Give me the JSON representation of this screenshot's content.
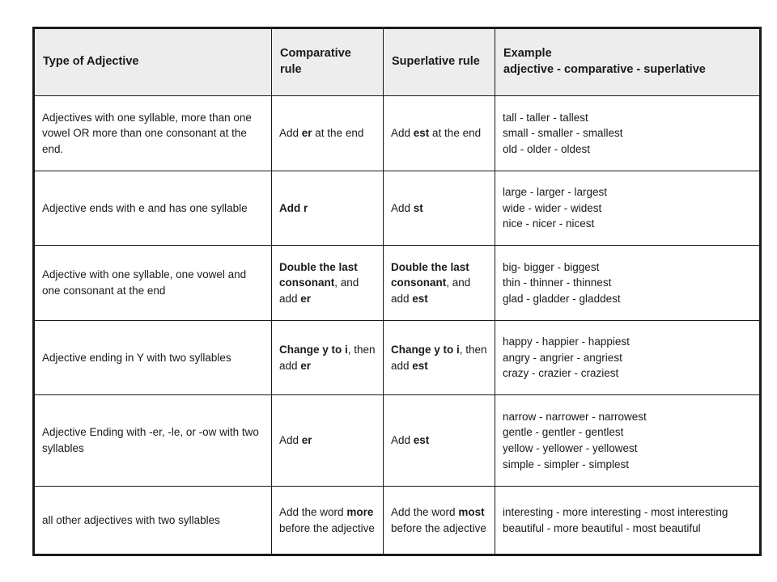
{
  "table": {
    "headers": [
      {
        "lines": [
          "Type of Adjective"
        ]
      },
      {
        "lines": [
          "Comparative",
          "rule"
        ]
      },
      {
        "lines": [
          "Superlative rule"
        ]
      },
      {
        "lines": [
          "Example",
          "adjective - comparative - superlative"
        ]
      }
    ],
    "rows": [
      {
        "type": "Adjectives with one syllable, more than one vowel OR more than one consonant at the end.",
        "comparative": {
          "segments": [
            {
              "t": "Add ",
              "b": false
            },
            {
              "t": "er",
              "b": true
            },
            {
              "t": " at the end",
              "b": false
            }
          ]
        },
        "superlative": {
          "segments": [
            {
              "t": "Add ",
              "b": false
            },
            {
              "t": "est",
              "b": true
            },
            {
              "t": " at the end",
              "b": false
            }
          ]
        },
        "examples": [
          "tall - taller - tallest",
          "small - smaller - smallest",
          "old - older - oldest"
        ]
      },
      {
        "type": "Adjective ends with e and has one syllable",
        "comparative": {
          "segments": [
            {
              "t": "Add r",
              "b": true
            }
          ]
        },
        "superlative": {
          "segments": [
            {
              "t": "Add ",
              "b": false
            },
            {
              "t": "st",
              "b": true
            }
          ]
        },
        "examples": [
          "large - larger - largest",
          "wide - wider - widest",
          "nice - nicer - nicest"
        ]
      },
      {
        "type": "Adjective with one syllable, one vowel and one consonant at the end",
        "comparative": {
          "segments": [
            {
              "t": "Double the last consonant",
              "b": true
            },
            {
              "t": ", and add ",
              "b": false
            },
            {
              "t": "er",
              "b": true
            }
          ]
        },
        "superlative": {
          "segments": [
            {
              "t": "Double the last consonant",
              "b": true
            },
            {
              "t": ", and add ",
              "b": false
            },
            {
              "t": "est",
              "b": true
            }
          ]
        },
        "examples": [
          "big- bigger - biggest",
          "thin - thinner - thinnest",
          "glad - gladder - gladdest"
        ]
      },
      {
        "type": "Adjective ending in Y with two syllables",
        "comparative": {
          "segments": [
            {
              "t": "Change y to i",
              "b": true
            },
            {
              "t": ", then add ",
              "b": false
            },
            {
              "t": "er",
              "b": true
            }
          ]
        },
        "superlative": {
          "segments": [
            {
              "t": "Change y to i",
              "b": true
            },
            {
              "t": ", then add ",
              "b": false
            },
            {
              "t": "est",
              "b": true
            }
          ]
        },
        "examples": [
          "happy - happier - happiest",
          "angry - angrier - angriest",
          "crazy - crazier - craziest"
        ]
      },
      {
        "type": "Adjective Ending with -er, -le, or -ow with two syllables",
        "comparative": {
          "segments": [
            {
              "t": "Add ",
              "b": false
            },
            {
              "t": "er",
              "b": true
            }
          ]
        },
        "superlative": {
          "segments": [
            {
              "t": "Add ",
              "b": false
            },
            {
              "t": "est",
              "b": true
            }
          ]
        },
        "examples": [
          "narrow - narrower - narrowest",
          "gentle - gentler - gentlest",
          "yellow - yellower - yellowest",
          "simple - simpler - simplest"
        ]
      },
      {
        "type": "all other adjectives with two syllables",
        "comparative": {
          "segments": [
            {
              "t": "Add the word ",
              "b": false
            },
            {
              "t": "more",
              "b": true
            },
            {
              "t": " before the adjective",
              "b": false
            }
          ]
        },
        "superlative": {
          "segments": [
            {
              "t": "Add the word ",
              "b": false
            },
            {
              "t": "most",
              "b": true
            },
            {
              "t": " before the adjective",
              "b": false
            }
          ]
        },
        "examples": [
          "interesting - more interesting - most interesting",
          "beautiful - more beautiful - most beautiful"
        ]
      }
    ]
  },
  "colors": {
    "header_background": "#ededed",
    "border": "#1a1a1a",
    "text": "#1a1a1a",
    "page_background": "#ffffff"
  }
}
